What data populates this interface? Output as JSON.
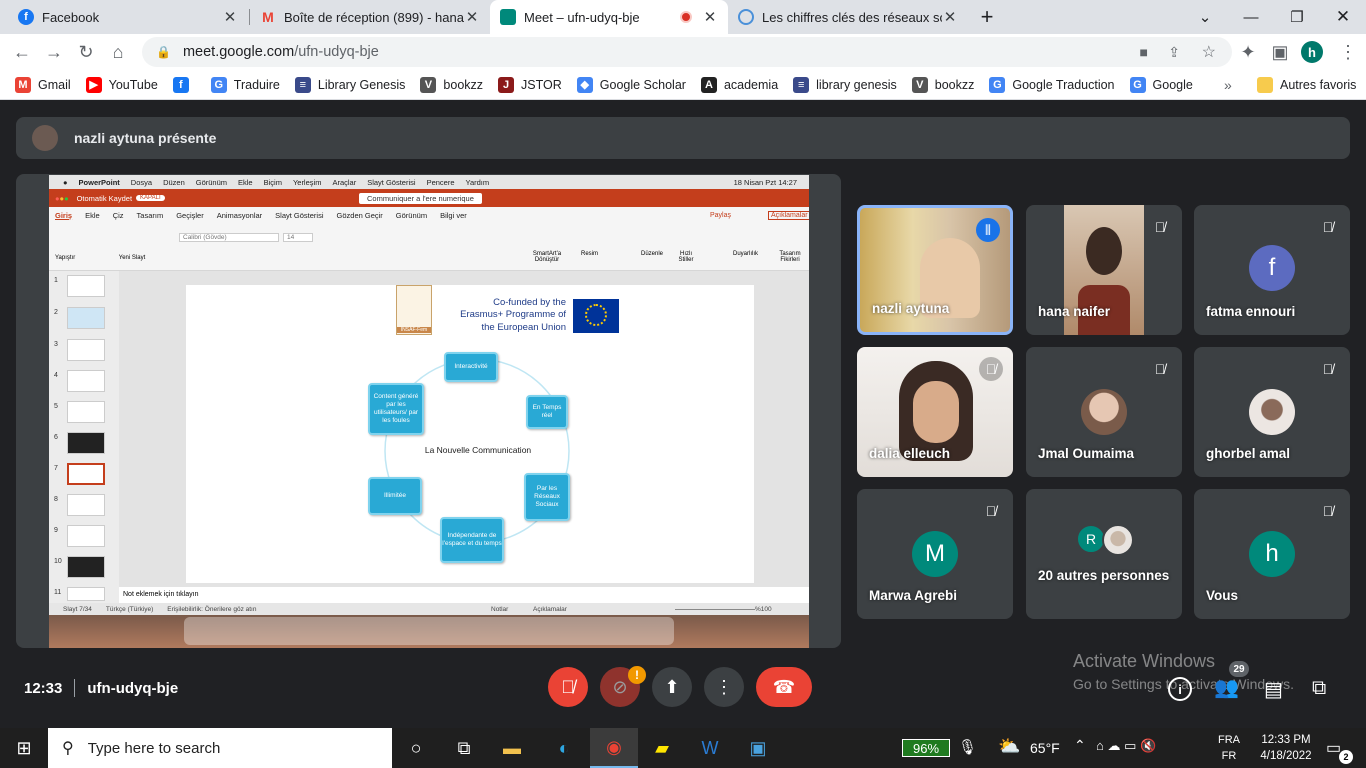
{
  "tabs": [
    {
      "title": "Facebook",
      "favicon": "facebook-icon",
      "color": "#1877f2"
    },
    {
      "title": "Boîte de réception (899) - hana.n",
      "favicon": "gmail-icon",
      "color": "#ea4335"
    },
    {
      "title": "Meet – ufn-udyq-bje",
      "favicon": "meet-icon",
      "color": "#00897b",
      "active": true
    },
    {
      "title": "Les chiffres clés des réseaux soci",
      "favicon": "site-icon",
      "color": "#4a90d9"
    }
  ],
  "new_tab": "+",
  "address": {
    "host": "meet.google.com",
    "path": "/ufn-udyq-bje"
  },
  "profile_initial": "h",
  "bookmarks": [
    {
      "label": "Gmail",
      "icon": "gmail-icon",
      "color": "#ea4335",
      "glyph": "M"
    },
    {
      "label": "YouTube",
      "icon": "youtube-icon",
      "color": "#ff0000",
      "glyph": "▶"
    },
    {
      "label": "",
      "icon": "facebook-icon",
      "color": "#1877f2",
      "glyph": "f"
    },
    {
      "label": "Traduire",
      "icon": "translate-icon",
      "color": "#4285f4",
      "glyph": "G"
    },
    {
      "label": "Library Genesis",
      "icon": "libgen-icon",
      "color": "#3a4a8a",
      "glyph": "≡"
    },
    {
      "label": "bookzz",
      "icon": "bookzz-icon",
      "color": "#555",
      "glyph": "V"
    },
    {
      "label": "JSTOR",
      "icon": "jstor-icon",
      "color": "#8b1a1a",
      "glyph": "J"
    },
    {
      "label": "Google Scholar",
      "icon": "scholar-icon",
      "color": "#4285f4",
      "glyph": "◆"
    },
    {
      "label": "academia",
      "icon": "academia-icon",
      "color": "#222",
      "glyph": "A"
    },
    {
      "label": "library genesis",
      "icon": "libgen-icon",
      "color": "#3a4a8a",
      "glyph": "≡"
    },
    {
      "label": "bookzz",
      "icon": "bookzz-icon",
      "color": "#555",
      "glyph": "V"
    },
    {
      "label": "Google Traduction",
      "icon": "translate-icon",
      "color": "#4285f4",
      "glyph": "G"
    },
    {
      "label": "Google",
      "icon": "google-icon",
      "color": "#4285f4",
      "glyph": "G"
    }
  ],
  "bookmarks_more": "»",
  "other_bookmarks": "Autres favoris",
  "presenting_banner": "nazli aytuna présente",
  "participants": [
    {
      "name": "nazli aytuna",
      "type": "video",
      "speaking": true
    },
    {
      "name": "hana naifer",
      "type": "video",
      "muted": true
    },
    {
      "name": "fatma ennouri",
      "type": "letter",
      "letter": "f",
      "color": "#5c6bc0",
      "muted": true
    },
    {
      "name": "dalia elleuch",
      "type": "video",
      "muted": true
    },
    {
      "name": "Jmal Oumaima",
      "type": "photo",
      "muted": true
    },
    {
      "name": "ghorbel amal",
      "type": "photo",
      "muted": true
    },
    {
      "name": "Marwa Agrebi",
      "type": "letter",
      "letter": "M",
      "color": "#00897b",
      "muted": true
    },
    {
      "name": "20 autres personnes",
      "type": "group",
      "letter": "R",
      "color": "#00897b"
    },
    {
      "name": "Vous",
      "type": "letter",
      "letter": "h",
      "color": "#00897b",
      "muted": true
    }
  ],
  "meeting": {
    "time": "12:33",
    "code": "ufn-udyq-bje",
    "participants_count": "29"
  },
  "watermark": {
    "line1": "Activate Windows",
    "line2": "Go to Settings to activate Windows."
  },
  "ppt": {
    "menu": [
      "PowerPoint",
      "Dosya",
      "Düzen",
      "Görünüm",
      "Ekle",
      "Biçim",
      "Yerleşim",
      "Araçlar",
      "Slayt Gösterisi",
      "Pencere",
      "Yardım"
    ],
    "clock": "18 Nisan Pzt  14:27",
    "autosave": "Otomatik Kaydet",
    "autosave_state": "KAPALI",
    "doc_title": "Communiquer a l'ere numerique",
    "ribbon_tabs": [
      "Giriş",
      "Ekle",
      "Çiz",
      "Tasarım",
      "Geçişler",
      "Animasyonlar",
      "Slayt Gösterisi",
      "Gözden Geçir",
      "Görünüm",
      "Bilgi ver"
    ],
    "share": "Paylaş",
    "comments": "Açıklamalar",
    "ribbon_labels": [
      "Yapıştır",
      "Yeni Slayt",
      "SmartArt'a Dönüştür",
      "Resim",
      "Düzenle",
      "Hızlı Stiller",
      "Duyarlılık",
      "Tasarım Fikirleri"
    ],
    "font": "Calibri (Gövde)",
    "font_size": "14",
    "slide_numbers": [
      "1",
      "2",
      "3",
      "4",
      "5",
      "6",
      "7",
      "8",
      "9",
      "10",
      "11"
    ],
    "funding": "Co-funded by the Erasmus+ Programme of the European Union",
    "logo_text": "INSAF-Fem",
    "center_label": "La Nouvelle Communication",
    "nodes": [
      "Interactivité",
      "En Temps réel",
      "Par les Réseaux Sociaux",
      "Indépendante de l'espace et du temps",
      "Illimitée",
      "Content généré par les utilisateurs/ par les foules"
    ],
    "notes_placeholder": "Not eklemek için tıklayın",
    "status_slide": "Slayt 7/34",
    "status_lang": "Türkçe (Türkiye)",
    "status_access": "Erişilebilirlik: Önerilere göz atın",
    "status_notes": "Notlar",
    "status_comments": "Açıklamalar",
    "zoom": "%100"
  },
  "taskbar": {
    "search_placeholder": "Type here to search",
    "battery": "96%",
    "weather": "65°F",
    "lang1": "FRA",
    "lang2": "FR",
    "time": "12:33 PM",
    "date": "4/18/2022",
    "notif": "2"
  }
}
